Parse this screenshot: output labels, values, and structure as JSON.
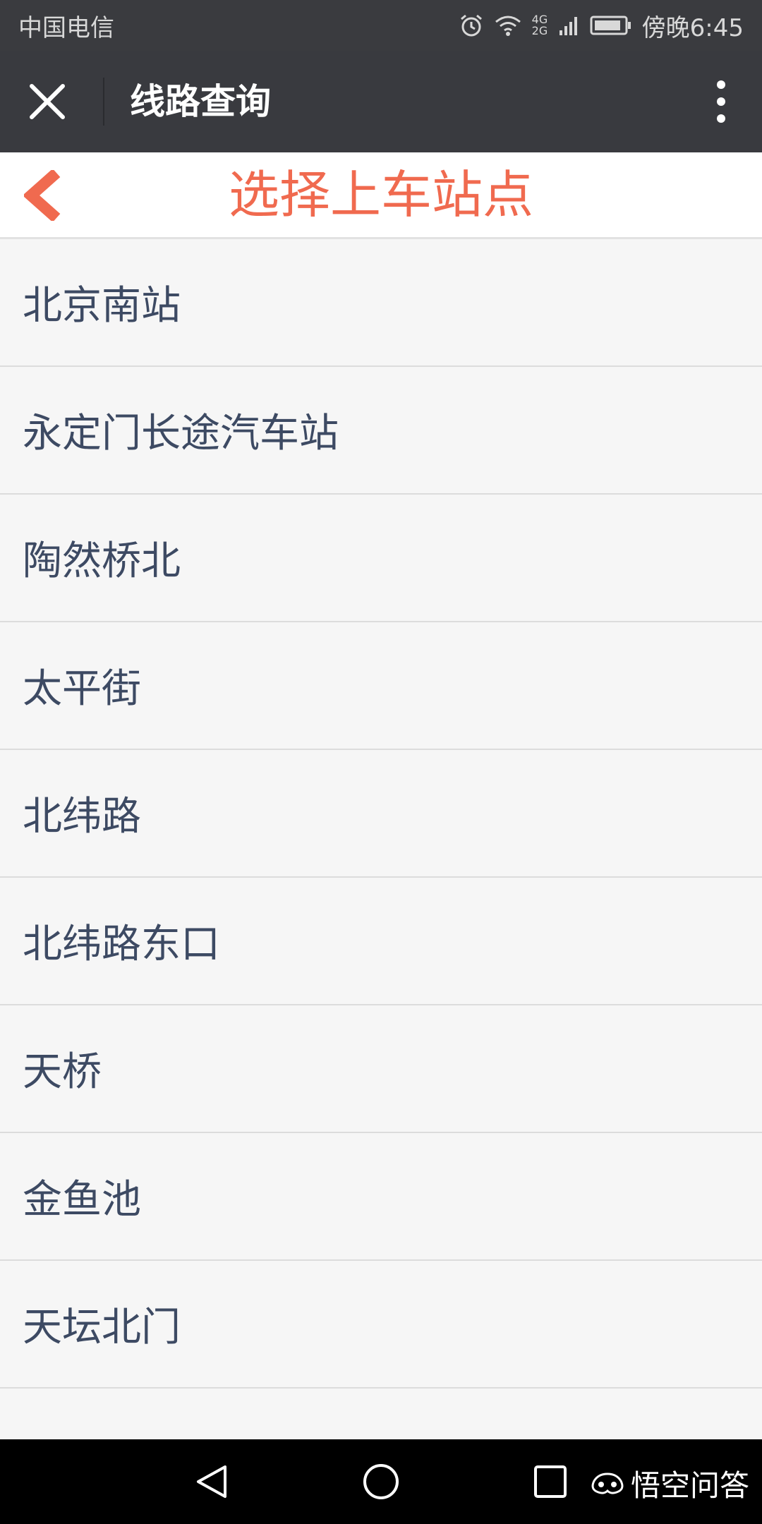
{
  "status_bar": {
    "carrier": "中国电信",
    "network": "4G 2G",
    "time": "傍晚6:45",
    "icons": [
      "alarm-icon",
      "wifi-icon",
      "signal-icon",
      "battery-icon"
    ]
  },
  "nav_bar": {
    "title": "线路查询",
    "icons": [
      "close-icon",
      "more-vertical-icon"
    ]
  },
  "page_header": {
    "title": "选择上车站点",
    "accent_color": "#f06a4f",
    "icons": [
      "back-chevron-icon"
    ]
  },
  "stations": [
    "北京南站",
    "永定门长途汽车站",
    "陶然桥北",
    "太平街",
    "北纬路",
    "北纬路东口",
    "天桥",
    "金鱼池",
    "天坛北门"
  ],
  "system_nav": {
    "icons": [
      "back-triangle-icon",
      "home-circle-icon",
      "recents-square-icon"
    ]
  },
  "watermark": {
    "text": "悟空问答"
  }
}
